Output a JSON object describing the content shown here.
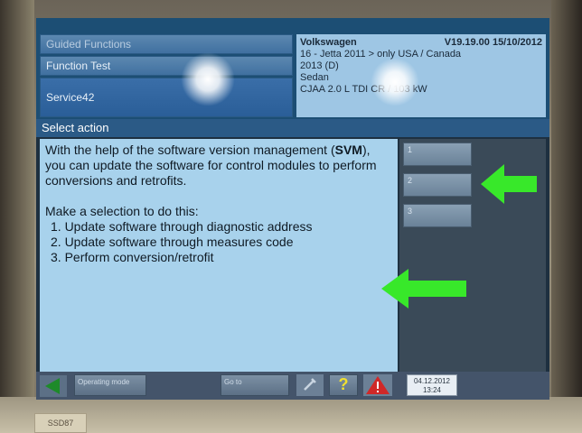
{
  "header": {
    "nav_items": [
      {
        "label": "Guided Functions"
      },
      {
        "label": "Function Test"
      },
      {
        "label": "Service42"
      }
    ],
    "vehicle": {
      "make": "Volkswagen",
      "version": "V19.19.00 15/10/2012",
      "line2": "16 - Jetta 2011 > only USA / Canada",
      "line3": "2013 (D)",
      "body": "Sedan",
      "engine": "CJAA 2.0 L TDI CR / 103 kW"
    }
  },
  "action_bar": {
    "title": "Select action"
  },
  "content": {
    "intro_prefix": "With the help of the software version management (",
    "intro_bold": "SVM",
    "intro_suffix": "), you can update the software for control modules to perform conversions and retrofits.",
    "selection_prompt": "Make a selection to do this:",
    "options": [
      "1. Update software through diagnostic address",
      "2. Update software through measures code",
      "3. Perform conversion/retrofit"
    ]
  },
  "side_buttons": [
    {
      "label": "1"
    },
    {
      "label": "2"
    },
    {
      "label": "3"
    }
  ],
  "bottom_bar": {
    "operating_mode": "Operating mode",
    "goto": "Go to",
    "help": "?",
    "date": "04.12.2012",
    "time": "13:24"
  },
  "sticker": {
    "text": "SSD87"
  },
  "colors": {
    "header_bg": "#1c4e74",
    "content_bg": "#a8d2ec",
    "arrow_green": "#38e82a",
    "warning_red": "#d02828"
  }
}
